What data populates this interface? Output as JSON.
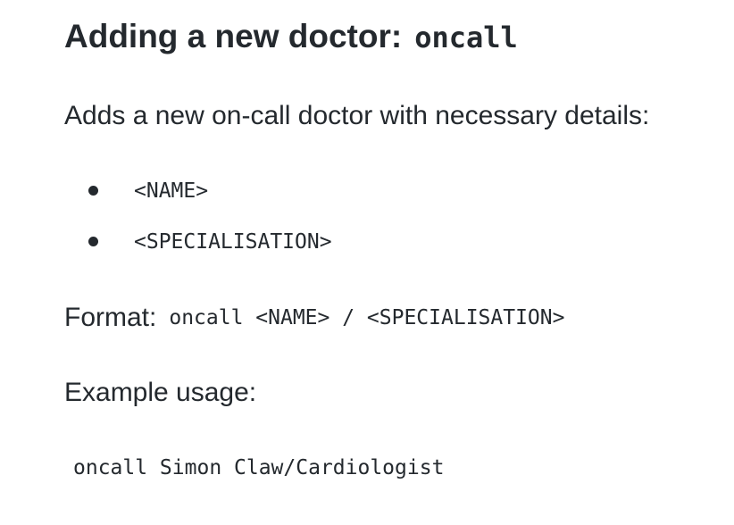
{
  "heading": {
    "text": "Adding a new doctor:",
    "command": "oncall"
  },
  "description": "Adds a new on-call doctor with necessary details:",
  "parameters": [
    "<NAME>",
    "<SPECIALISATION>"
  ],
  "format": {
    "label": "Format:",
    "code": "oncall <NAME> / <SPECIALISATION>"
  },
  "example": {
    "label": "Example usage:",
    "code": "oncall Simon Claw/Cardiologist"
  }
}
